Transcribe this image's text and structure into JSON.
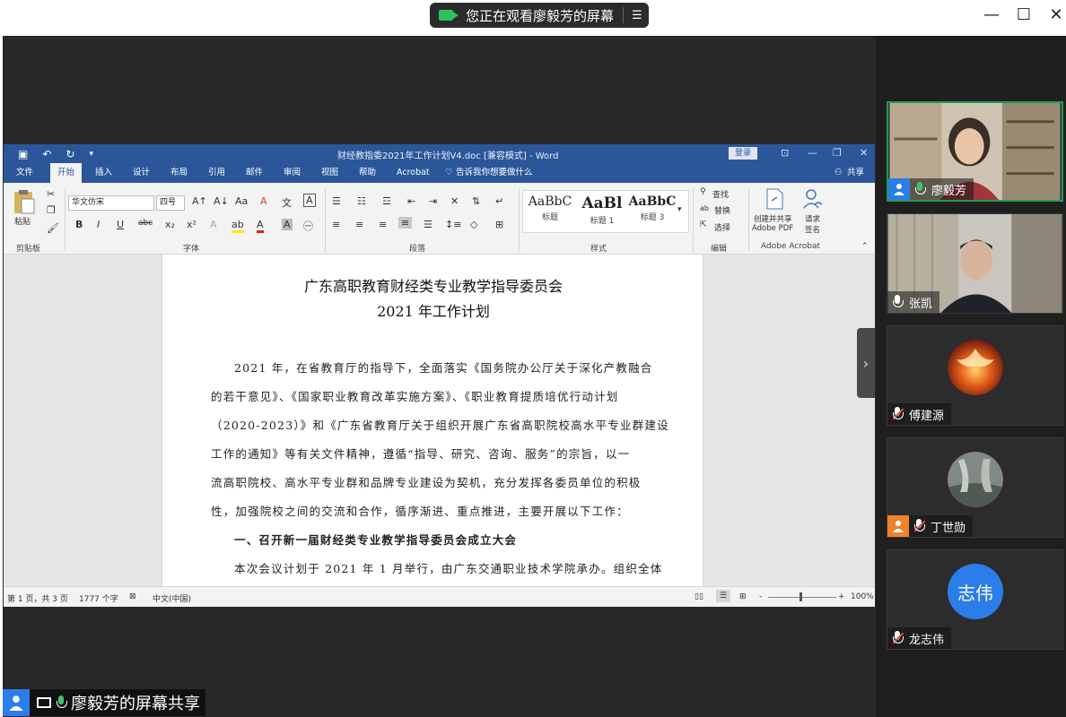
{
  "meeting": {
    "sharing_banner": "您正在观看廖毅芳的屏幕",
    "bottom_label": "廖毅芳的屏幕共享",
    "window_controls": {
      "minimize": "—",
      "maximize": "☐",
      "close": "✕"
    }
  },
  "participants": [
    {
      "name": "廖毅芳",
      "mic": "on",
      "video": true,
      "speaking": true
    },
    {
      "name": "张凯",
      "mic": "on",
      "video": true
    },
    {
      "name": "傅建源",
      "mic": "off",
      "avatar": "phoenix-image"
    },
    {
      "name": "丁世勋",
      "mic": "off",
      "avatar": "landscape-image"
    },
    {
      "name": "龙志伟",
      "mic": "off",
      "avatar_text": "志伟",
      "avatar_color": "#2b7de9"
    }
  ],
  "word": {
    "doc_title": "财经教指委2021年工作计划V4.doc [兼容模式] - Word",
    "login": "登录",
    "tabs": [
      "文件",
      "开始",
      "插入",
      "设计",
      "布局",
      "引用",
      "邮件",
      "审阅",
      "视图",
      "帮助",
      "Acrobat"
    ],
    "active_tab": "开始",
    "tell_me": "告诉我你想要做什么",
    "share": "共享",
    "ribbon": {
      "paste_label": "粘贴",
      "font_name": "华文仿宋",
      "font_size": "四号",
      "groups": [
        "剪贴板",
        "字体",
        "段落",
        "样式",
        "编辑",
        "Adobe Acrobat"
      ],
      "styles": [
        {
          "sample": "AaBbC",
          "name": "标题"
        },
        {
          "sample": "AaBl",
          "name": "标题 1"
        },
        {
          "sample": "AaBbC",
          "name": "标题 3"
        }
      ],
      "edit": {
        "find": "查找",
        "replace": "替换",
        "select": "选择"
      },
      "acrobat": {
        "create": "创建并共享",
        "create2": "Adobe PDF",
        "request": "请求",
        "request2": "签名"
      }
    },
    "document": {
      "title1": "广东高职教育财经类专业教学指导委员会",
      "title2": "2021 年工作计划",
      "lines": [
        "2021 年，在省教育厅的指导下，全面落实《国务院办公厅关于深化产教融合",
        "的若干意见》、《国家职业教育改革实施方案》、《职业教育提质培优行动计划",
        "（2020-2023）》和《广东省教育厅关于组织开展广东省高职院校高水平专业群建设",
        "工作的通知》等有关文件精神，遵循“指导、研究、咨询、服务”的宗旨，以一",
        "流高职院校、高水平专业群和品牌专业建设为契机，充分发挥各委员单位的积极",
        "性，加强院校之间的交流和合作，循序渐进、重点推进，主要开展以下工作：",
        "一、召开新一届财经类专业教学指导委员会成立大会",
        "本次会议计划于 2021 年 1 月举行，由广东交通职业技术学院承办。组织全体"
      ]
    },
    "status": {
      "page": "第 1 页，共 3 页",
      "words": "1777 个字",
      "language": "中文(中国)",
      "zoom": "100%",
      "zoom_minus": "-",
      "zoom_plus": "+"
    }
  }
}
